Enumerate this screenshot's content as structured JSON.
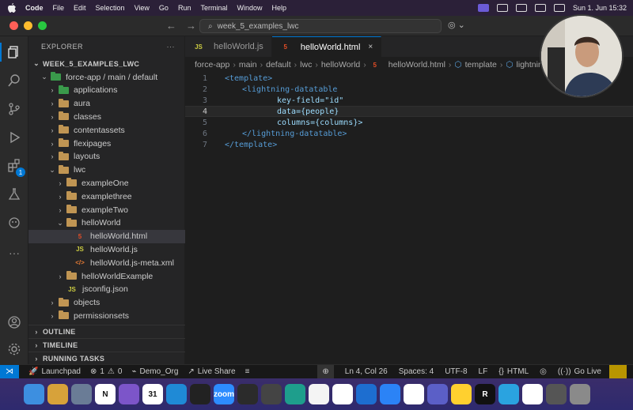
{
  "menubar": {
    "app": "Code",
    "items": [
      "File",
      "Edit",
      "Selection",
      "View",
      "Go",
      "Run",
      "Terminal",
      "Window",
      "Help"
    ],
    "clock": "Sun 1. Jun  15:32"
  },
  "titlebar": {
    "command_center": "week_5_examples_lwc"
  },
  "sidebar": {
    "title": "EXPLORER",
    "workspace": "WEEK_5_EXAMPLES_LWC",
    "tree": [
      {
        "label": "force-app / main / default",
        "kind": "folder-green",
        "depth": 1,
        "expanded": true
      },
      {
        "label": "applications",
        "kind": "folder-green",
        "depth": 2,
        "expanded": false
      },
      {
        "label": "aura",
        "kind": "folder",
        "depth": 2,
        "expanded": false
      },
      {
        "label": "classes",
        "kind": "folder",
        "depth": 2,
        "expanded": false
      },
      {
        "label": "contentassets",
        "kind": "folder",
        "depth": 2,
        "expanded": false
      },
      {
        "label": "flexipages",
        "kind": "folder",
        "depth": 2,
        "expanded": false
      },
      {
        "label": "layouts",
        "kind": "folder",
        "depth": 2,
        "expanded": false
      },
      {
        "label": "lwc",
        "kind": "folder",
        "depth": 2,
        "expanded": true
      },
      {
        "label": "exampleOne",
        "kind": "folder",
        "depth": 3,
        "expanded": false
      },
      {
        "label": "examplethree",
        "kind": "folder",
        "depth": 3,
        "expanded": false
      },
      {
        "label": "exampleTwo",
        "kind": "folder",
        "depth": 3,
        "expanded": false
      },
      {
        "label": "helloWorld",
        "kind": "folder",
        "depth": 3,
        "expanded": true
      },
      {
        "label": "helloWorld.html",
        "kind": "html",
        "depth": 4,
        "selected": true
      },
      {
        "label": "helloWorld.js",
        "kind": "js",
        "depth": 4
      },
      {
        "label": "helloWorld.js-meta.xml",
        "kind": "xml",
        "depth": 4
      },
      {
        "label": "helloWorldExample",
        "kind": "folder",
        "depth": 3,
        "expanded": false
      },
      {
        "label": "jsconfig.json",
        "kind": "json",
        "depth": 3
      },
      {
        "label": "objects",
        "kind": "folder",
        "depth": 2,
        "expanded": false
      },
      {
        "label": "permissionsets",
        "kind": "folder",
        "depth": 2,
        "expanded": false
      }
    ],
    "sections": [
      "OUTLINE",
      "TIMELINE",
      "RUNNING TASKS"
    ]
  },
  "tabs": [
    {
      "label": "helloWorld.js",
      "icon": "JS",
      "active": false
    },
    {
      "label": "helloWorld.html",
      "icon": "5",
      "active": true,
      "close": "×"
    }
  ],
  "breadcrumb": [
    "force-app",
    "main",
    "default",
    "lwc",
    "helloWorld",
    "helloWorld.html",
    "template",
    "lightnin"
  ],
  "editor": {
    "current_line": 4,
    "lines": [
      {
        "n": "1",
        "text": "<template>"
      },
      {
        "n": "2",
        "text": "<lightning-datatable"
      },
      {
        "n": "3",
        "text": "key-field=\"id\""
      },
      {
        "n": "4",
        "text": "data={people}"
      },
      {
        "n": "5",
        "text": "columns={columns}>"
      },
      {
        "n": "6",
        "text": "</lightning-datatable>"
      },
      {
        "n": "7",
        "text": "</template>"
      }
    ]
  },
  "statusbar": {
    "launchpad": "Launchpad",
    "errors": "1",
    "warnings": "0",
    "org": "Demo_Org",
    "live_share": "Live Share",
    "position": "Ln 4, Col 26",
    "spaces": "Spaces: 4",
    "encoding": "UTF-8",
    "eol": "LF",
    "language": "HTML",
    "go_live": "Go Live"
  },
  "dock": [
    {
      "name": "finder",
      "color": "#3d8fe0",
      "glyph": ""
    },
    {
      "name": "launchpad",
      "color": "#d7a23a",
      "glyph": ""
    },
    {
      "name": "safari",
      "color": "#6a7c96",
      "glyph": ""
    },
    {
      "name": "notion",
      "color": "#ffffff",
      "glyph": "N"
    },
    {
      "name": "obsidian",
      "color": "#7c55c9",
      "glyph": ""
    },
    {
      "name": "calendar",
      "color": "#ffffff",
      "glyph": "31"
    },
    {
      "name": "vscode",
      "color": "#1f8ad6",
      "glyph": ""
    },
    {
      "name": "cube",
      "color": "#222222",
      "glyph": ""
    },
    {
      "name": "zoom",
      "color": "#2d8cff",
      "glyph": "zoom"
    },
    {
      "name": "obs",
      "color": "#2b2b2b",
      "glyph": ""
    },
    {
      "name": "davinci",
      "color": "#444444",
      "glyph": ""
    },
    {
      "name": "edge",
      "color": "#1e9e8c",
      "glyph": ""
    },
    {
      "name": "mongodb",
      "color": "#f4f4f4",
      "glyph": ""
    },
    {
      "name": "slack",
      "color": "#ffffff",
      "glyph": ""
    },
    {
      "name": "trello",
      "color": "#1d6ed0",
      "glyph": ""
    },
    {
      "name": "perplexity",
      "color": "#2b83f6",
      "glyph": ""
    },
    {
      "name": "chatgpt",
      "color": "#ffffff",
      "glyph": ""
    },
    {
      "name": "teams",
      "color": "#5b5fc7",
      "glyph": ""
    },
    {
      "name": "miro",
      "color": "#ffd02f",
      "glyph": ""
    },
    {
      "name": "r",
      "color": "#111111",
      "glyph": "R"
    },
    {
      "name": "telegram",
      "color": "#2aa3e0",
      "glyph": ""
    },
    {
      "name": "proton",
      "color": "#ffffff",
      "glyph": ""
    },
    {
      "name": "preview",
      "color": "#555555",
      "glyph": ""
    },
    {
      "name": "trash",
      "color": "#8a8a8a",
      "glyph": ""
    }
  ]
}
